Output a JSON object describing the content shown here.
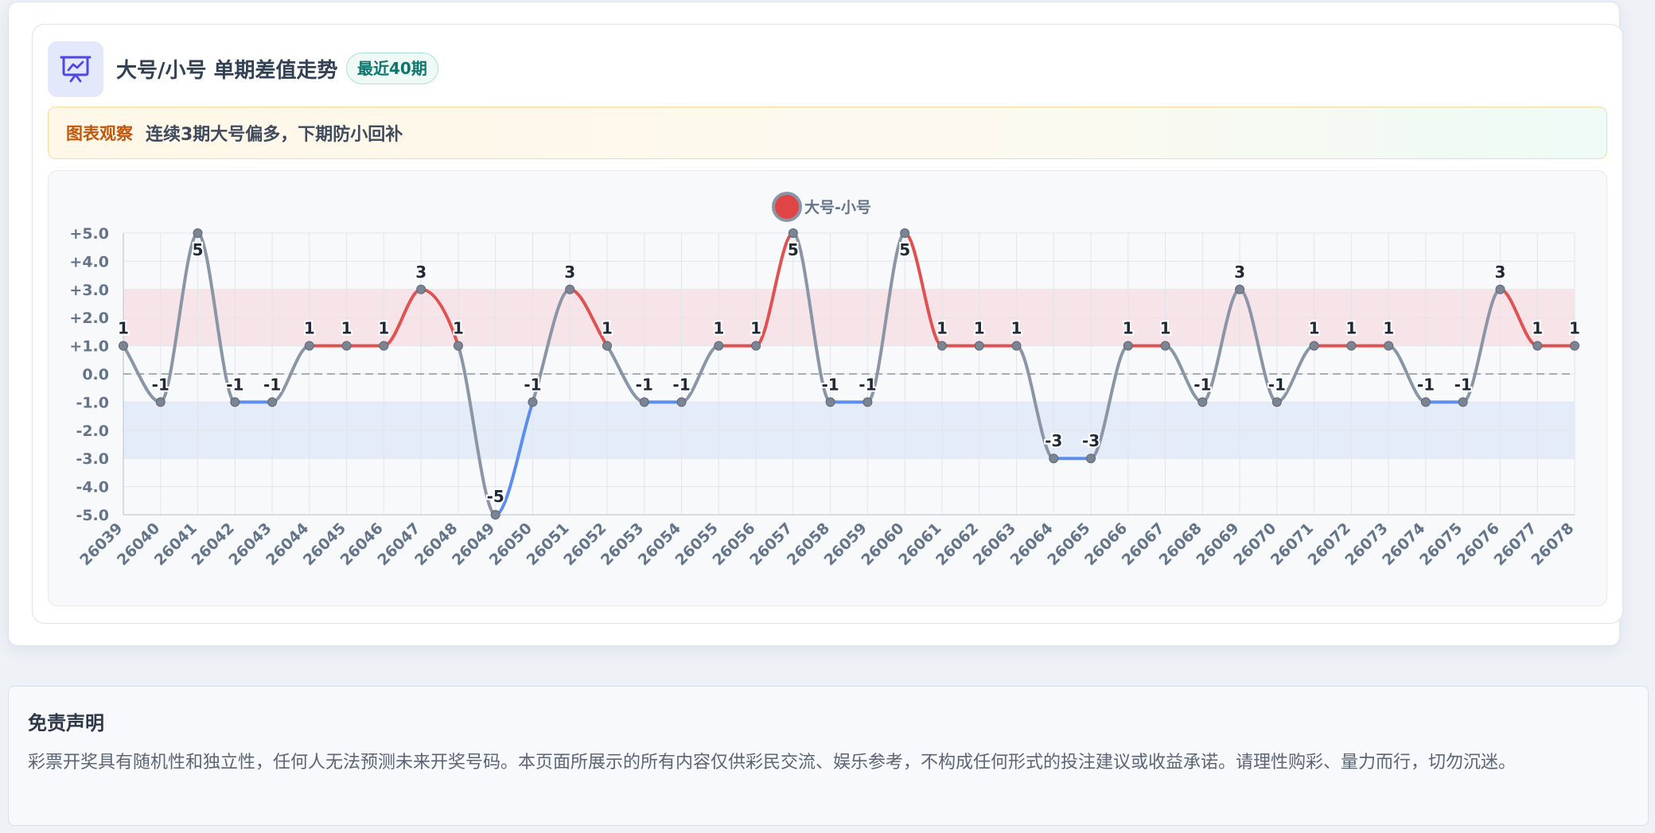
{
  "header": {
    "title": "大号/小号 单期差值走势",
    "badge": "最近40期",
    "icon": "chart-presentation-icon"
  },
  "insight": {
    "label": "图表观察",
    "text": "连续3期大号偏多，下期防小回补"
  },
  "chart_data": {
    "type": "line",
    "series": [
      {
        "name": "大号-小号",
        "values": [
          1,
          -1,
          5,
          -1,
          -1,
          1,
          1,
          1,
          3,
          1,
          -5,
          -1,
          3,
          1,
          -1,
          -1,
          1,
          1,
          5,
          -1,
          -1,
          5,
          1,
          1,
          1,
          -3,
          -3,
          1,
          1,
          -1,
          3,
          -1,
          1,
          1,
          1,
          -1,
          -1,
          3,
          1,
          1
        ]
      }
    ],
    "categories": [
      "26039",
      "26040",
      "26041",
      "26042",
      "26043",
      "26044",
      "26045",
      "26046",
      "26047",
      "26048",
      "26049",
      "26050",
      "26051",
      "26052",
      "26053",
      "26054",
      "26055",
      "26056",
      "26057",
      "26058",
      "26059",
      "26060",
      "26061",
      "26062",
      "26063",
      "26064",
      "26065",
      "26066",
      "26067",
      "26068",
      "26069",
      "26070",
      "26071",
      "26072",
      "26073",
      "26074",
      "26075",
      "26076",
      "26077",
      "26078"
    ],
    "yticks": [
      "+5.0",
      "+4.0",
      "+3.0",
      "+2.0",
      "+1.0",
      "0.0",
      "-1.0",
      "-2.0",
      "-3.0",
      "-4.0",
      "-5.0"
    ],
    "ylim": [
      -5,
      5
    ],
    "bands": [
      {
        "from": 1,
        "to": 3,
        "color": "#f7e4e8"
      },
      {
        "from": -3,
        "to": -1,
        "color": "#e4ecfa"
      }
    ],
    "baseline": 0,
    "grid": true,
    "legend_position": "top-center",
    "smooth": true,
    "colors": {
      "positive": "#e05252",
      "negative": "#5b8def",
      "neutral": "#8a95a6",
      "marker_fill": "#7b8493",
      "legend_fill": "#e04545",
      "legend_ring": "#8a95a6"
    }
  },
  "disclaimer": {
    "title": "免责声明",
    "text": "彩票开奖具有随机性和独立性，任何人无法预测未来开奖号码。本页面所展示的所有内容仅供彩民交流、娱乐参考，不构成任何形式的投注建议或收益承诺。请理性购彩、量力而行，切勿沉迷。"
  }
}
